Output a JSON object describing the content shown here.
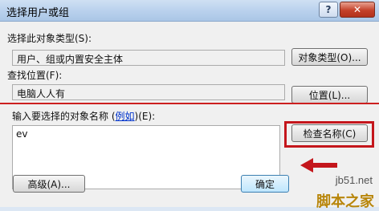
{
  "window": {
    "title": "选择用户或组",
    "help_label": "?",
    "close_label": "✕"
  },
  "object_type": {
    "label": "选择此对象类型(S):",
    "value": "用户、组或内置安全主体",
    "button": "对象类型(O)..."
  },
  "location": {
    "label": "查找位置(F):",
    "value": "电脑人人有",
    "button": "位置(L)..."
  },
  "names": {
    "label_prefix": "输入要选择的对象名称 (",
    "label_link": "例如",
    "label_suffix": ")(E):",
    "value": "ev",
    "check_button": "检查名称(C)"
  },
  "footer": {
    "advanced_button": "高级(A)...",
    "ok_button": "确定"
  },
  "watermark": {
    "url": "jb51.net",
    "name": "脚本之家"
  },
  "colors": {
    "annotation_red": "#c4161c"
  }
}
